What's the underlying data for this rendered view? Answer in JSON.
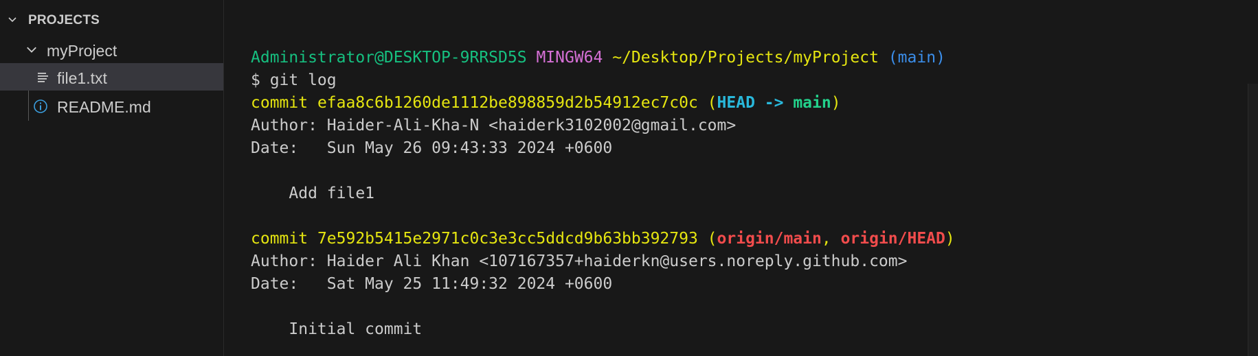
{
  "explorer": {
    "section_title": "PROJECTS",
    "folder": {
      "label": "myProject"
    },
    "files": [
      {
        "label": "file1.txt",
        "icon": "text-file-icon",
        "selected": true
      },
      {
        "label": "README.md",
        "icon": "info-icon",
        "selected": false
      }
    ]
  },
  "terminal": {
    "prompt": {
      "user_host": "Administrator@DESKTOP-9RRSD5S",
      "shell": "MINGW64",
      "path": "~/Desktop/Projects/myProject",
      "branch": "(main)"
    },
    "command": "$ git log",
    "commits": [
      {
        "prefix": "commit ",
        "hash": "efaa8c6b1260de1112be898859d2b54912ec7c0c",
        "ref_open": " (",
        "ref_head": "HEAD -> ",
        "ref_main": "main",
        "ref_close": ")",
        "author": "Author: Haider-Ali-Kha-N <haiderk3102002@gmail.com>",
        "date": "Date:   Sun May 26 09:43:33 2024 +0600",
        "message": "    Add file1"
      },
      {
        "prefix": "commit ",
        "hash": "7e592b5415e2971c0c3e3cc5ddcd9b63bb392793",
        "ref_open": " (",
        "ref_origin_main": "origin/main",
        "ref_sep": ", ",
        "ref_origin_head": "origin/HEAD",
        "ref_close": ")",
        "author": "Author: Haider Ali Khan <107167357+haiderkn@users.noreply.github.com>",
        "date": "Date:   Sat May 25 11:49:32 2024 +0600",
        "message": "    Initial commit"
      }
    ]
  },
  "colors": {
    "background": "#181818",
    "selection": "#37373d",
    "prompt_user": "#23d18b",
    "prompt_shell": "#d670d6",
    "prompt_path": "#f5f543",
    "prompt_branch": "#3b8eea",
    "commit_hash": "#f5f543",
    "ref_head": "#29b8db",
    "ref_branch": "#23d18b",
    "ref_origin": "#f14c4c"
  }
}
